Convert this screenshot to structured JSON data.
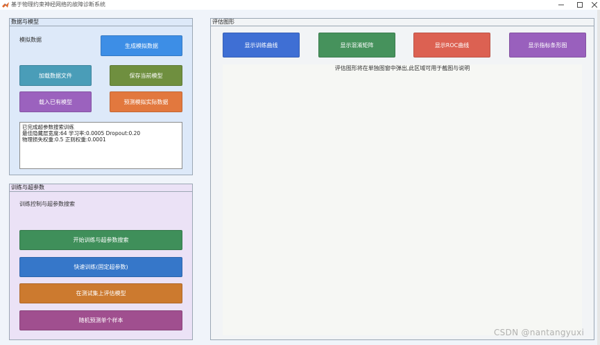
{
  "window": {
    "title": "基于物理约束神经网络的故障诊断系统",
    "min_icon": "minimize-icon",
    "max_icon": "maximize-icon",
    "close_icon": "close-icon"
  },
  "data_panel": {
    "title": "数据与模型",
    "note": "模拟数据",
    "buttons": {
      "generate": "生成模拟数据",
      "load_file": "加载数据文件",
      "save_model": "保存当前模型",
      "load_model": "载入已有模型",
      "predict_real": "预测模拟实际数据"
    },
    "log_lines": [
      "已完成超参数搜索训练",
      "最佳隐藏层宽度:64 学习率:0.0005 Dropout:0.20",
      "物理损失权重:0.5 正则权重:0.0001"
    ]
  },
  "train_panel": {
    "title": "训练与超参数",
    "note": "训练控制与超参数搜索",
    "buttons": {
      "start_search": "开始训练与超参数搜索",
      "quick_train": "快速训练(固定超参数)",
      "evaluate_test": "在测试集上评估模型",
      "random_predict": "随机预测单个样本"
    }
  },
  "eval_panel": {
    "title": "评估图形",
    "buttons": {
      "curves": "显示训练曲线",
      "confusion": "显示混淆矩阵",
      "roc": "显示ROC曲线",
      "metrics_bar": "显示指标条形图"
    },
    "note": "评估图形将在单独图窗中弹出,此区域可用于截图与说明"
  },
  "watermark": "CSDN @nantangyuxi",
  "colors": {
    "blue": "#3d8ee6",
    "teal": "#4a9db8",
    "olive": "#6f8f3f",
    "purple": "#9b62be",
    "orange": "#e2783e",
    "green": "#3f8f5a",
    "red": "#dc6152"
  }
}
